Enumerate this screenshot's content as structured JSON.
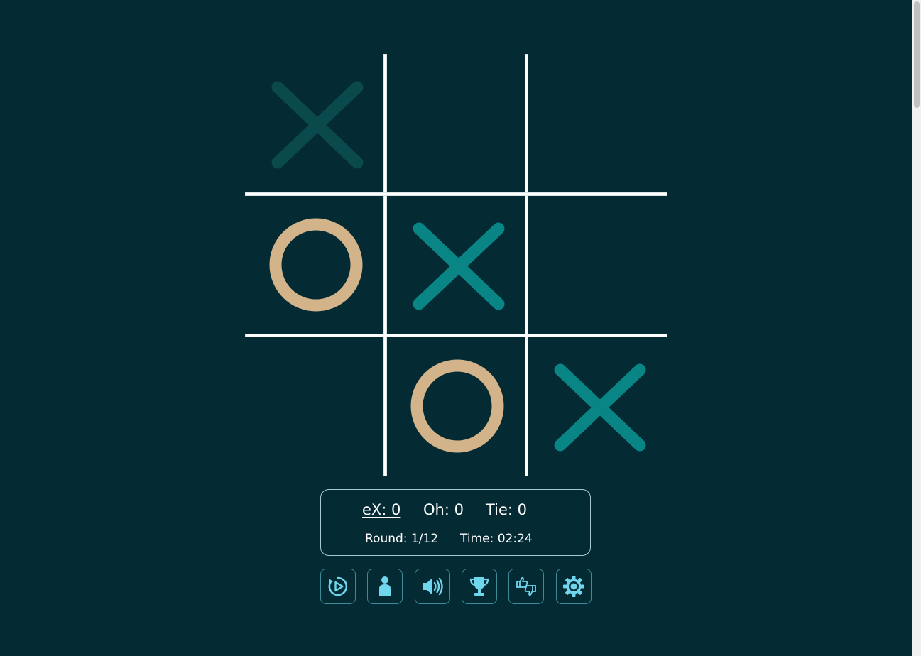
{
  "board": {
    "cells": [
      "X-faded",
      "",
      "",
      "O",
      "X",
      "",
      "",
      "O",
      "X"
    ]
  },
  "colors": {
    "background": "#042a33",
    "grid": "#ffffff",
    "x_mark": "#0a8585",
    "x_mark_faded": "#0b4a4c",
    "o_mark": "#d3b48a",
    "icon": "#6fd6ee",
    "panel_border": "#a9c9cf"
  },
  "score": {
    "x_label": "eX: 0",
    "o_label": "Oh: 0",
    "tie_label": "Tie: 0"
  },
  "info": {
    "round": "Round: 1/12",
    "time": "Time: 02:24"
  },
  "toolbar": {
    "buttons": [
      {
        "icon": "restart-play-icon"
      },
      {
        "icon": "person-icon"
      },
      {
        "icon": "speaker-icon"
      },
      {
        "icon": "trophy-icon"
      },
      {
        "icon": "thumbs-up-down-icon"
      },
      {
        "icon": "gear-icon"
      }
    ]
  }
}
